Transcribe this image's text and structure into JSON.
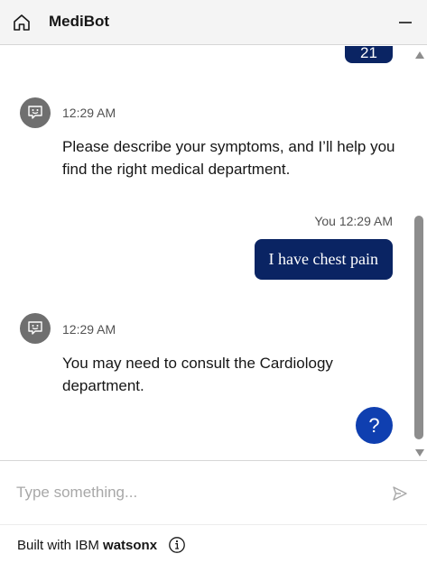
{
  "header": {
    "title": "MediBot",
    "home_icon": "home-icon",
    "minimize_icon": "minimize-icon"
  },
  "conversation": {
    "previous_user_bubble_text": "21",
    "messages": [
      {
        "sender": "bot",
        "time": "12:29 AM",
        "text": "Please describe your symptoms, and I’ll help you find the right medical department."
      },
      {
        "sender": "user",
        "sender_label": "You",
        "time": "12:29 AM",
        "text": "I have chest pain"
      },
      {
        "sender": "bot",
        "time": "12:29 AM",
        "text": "You may need to consult the Cardiology department."
      }
    ],
    "help_button_label": "?"
  },
  "input": {
    "placeholder": "Type something...",
    "value": "",
    "send_icon": "send-icon"
  },
  "footer": {
    "built_with": "Built with IBM",
    "brand": "watsonx",
    "info_icon": "info-icon"
  },
  "colors": {
    "header_bg": "#f4f4f4",
    "user_bubble": "#0a2463",
    "bot_avatar": "#6f6f6f",
    "help_button": "#0f3fb0"
  }
}
